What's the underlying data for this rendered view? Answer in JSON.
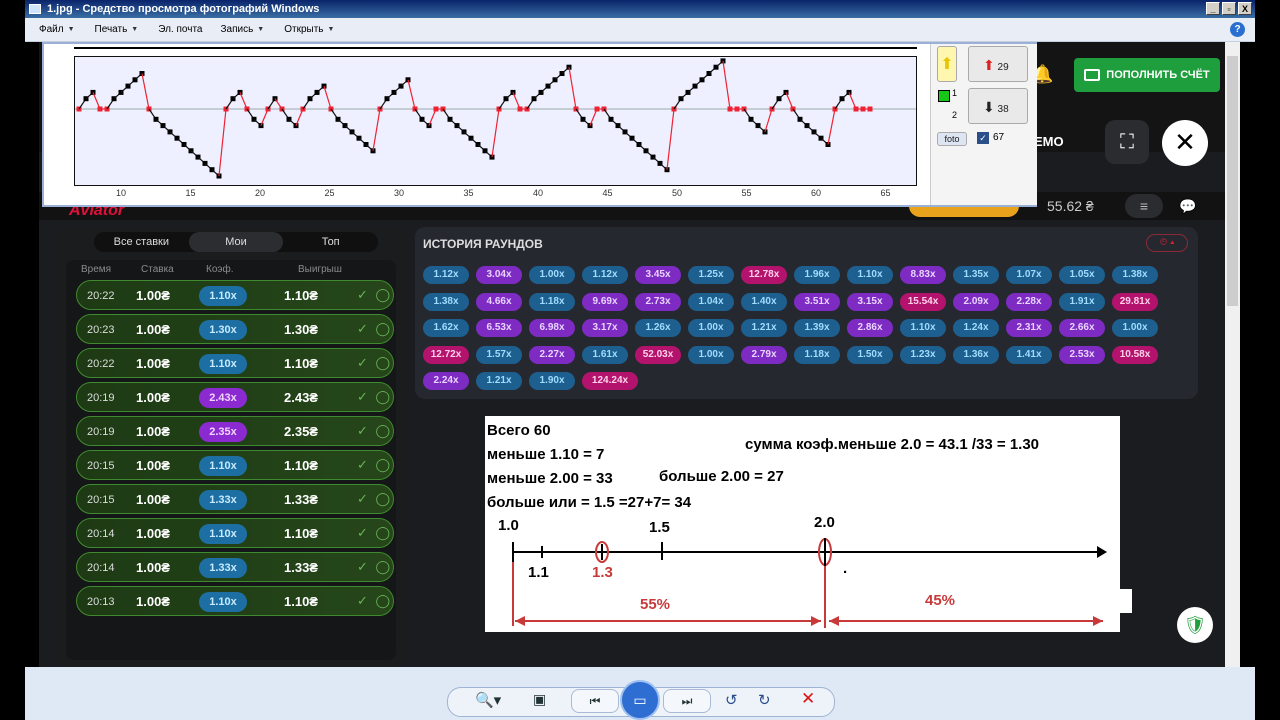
{
  "window": {
    "title": "1.jpg - Средство просмотра фотографий Windows",
    "controls": [
      "_",
      "▫",
      "X"
    ]
  },
  "menu": [
    "Файл",
    "Печать",
    "Эл. почта",
    "Запись",
    "Открыть"
  ],
  "header": {
    "deposit_label": "ПОПОЛНИТЬ СЧЁТ",
    "demo_label": "ЕМО",
    "balance": "55.62 ₴",
    "brand": "Aviator"
  },
  "stats": {
    "up_count": "29",
    "down_count": "38",
    "small_top": "1",
    "small_bottom": "2",
    "foto_label": "foto",
    "check_count": "67",
    "x_ticks": [
      "10",
      "15",
      "20",
      "25",
      "30",
      "35",
      "40",
      "45",
      "50",
      "55",
      "60",
      "65"
    ]
  },
  "bets": {
    "tabs": [
      "Все ставки",
      "Мои",
      "Топ"
    ],
    "columns": [
      "Время",
      "Ставка",
      "Коэф.",
      "Выигрыш"
    ],
    "rows": [
      {
        "time": "20:22",
        "stake": "1.00₴",
        "coef": "1.10x",
        "win": "1.10₴",
        "color": "blue"
      },
      {
        "time": "20:23",
        "stake": "1.00₴",
        "coef": "1.30x",
        "win": "1.30₴",
        "color": "blue"
      },
      {
        "time": "20:22",
        "stake": "1.00₴",
        "coef": "1.10x",
        "win": "1.10₴",
        "color": "blue"
      },
      {
        "time": "20:19",
        "stake": "1.00₴",
        "coef": "2.43x",
        "win": "2.43₴",
        "color": "purple"
      },
      {
        "time": "20:19",
        "stake": "1.00₴",
        "coef": "2.35x",
        "win": "2.35₴",
        "color": "purple"
      },
      {
        "time": "20:15",
        "stake": "1.00₴",
        "coef": "1.10x",
        "win": "1.10₴",
        "color": "blue"
      },
      {
        "time": "20:15",
        "stake": "1.00₴",
        "coef": "1.33x",
        "win": "1.33₴",
        "color": "blue"
      },
      {
        "time": "20:14",
        "stake": "1.00₴",
        "coef": "1.10x",
        "win": "1.10₴",
        "color": "blue"
      },
      {
        "time": "20:14",
        "stake": "1.00₴",
        "coef": "1.33x",
        "win": "1.33₴",
        "color": "blue"
      },
      {
        "time": "20:13",
        "stake": "1.00₴",
        "coef": "1.10x",
        "win": "1.10₴",
        "color": "blue"
      }
    ]
  },
  "history": {
    "title": "ИСТОРИЯ РАУНДОВ",
    "rows": [
      [
        "1.12x",
        "3.04x",
        "1.00x",
        "1.12x",
        "3.45x",
        "1.25x",
        "12.78x",
        "1.96x",
        "1.10x",
        "8.83x",
        "1.35x",
        "1.07x",
        "1.05x",
        "1.38x"
      ],
      [
        "1.38x",
        "4.66x",
        "1.18x",
        "9.69x",
        "2.73x",
        "1.04x",
        "1.40x",
        "3.51x",
        "3.15x",
        "15.54x",
        "2.09x",
        "2.28x",
        "1.91x",
        "29.81x"
      ],
      [
        "1.62x",
        "6.53x",
        "6.98x",
        "3.17x",
        "1.26x",
        "1.00x",
        "1.21x",
        "1.39x",
        "2.86x",
        "1.10x",
        "1.24x",
        "2.31x",
        "2.66x",
        "1.00x"
      ],
      [
        "12.72x",
        "1.57x",
        "2.27x",
        "1.61x",
        "52.03x",
        "1.00x",
        "2.79x",
        "1.18x",
        "1.50x",
        "1.23x",
        "1.36x",
        "1.41x",
        "2.53x",
        "10.58x"
      ],
      [
        "2.24x",
        "1.21x",
        "1.90x",
        "124.24x"
      ]
    ]
  },
  "note": {
    "total": "Всего 60",
    "less110": "меньше 1.10 = 7",
    "less200": "меньше 2.00 = 33",
    "more200": "больше 2.00 = 27",
    "more15": "больше или = 1.5 =27+7= 34",
    "sum": "сумма коэф.меньше 2.0 = 43.1 /33 = 1.30",
    "l10": "1.0",
    "l11": "1.1",
    "l13": "1.3",
    "l15": "1.5",
    "l20": "2.0",
    "p55": "55%",
    "p45": "45%",
    "dot": "."
  }
}
